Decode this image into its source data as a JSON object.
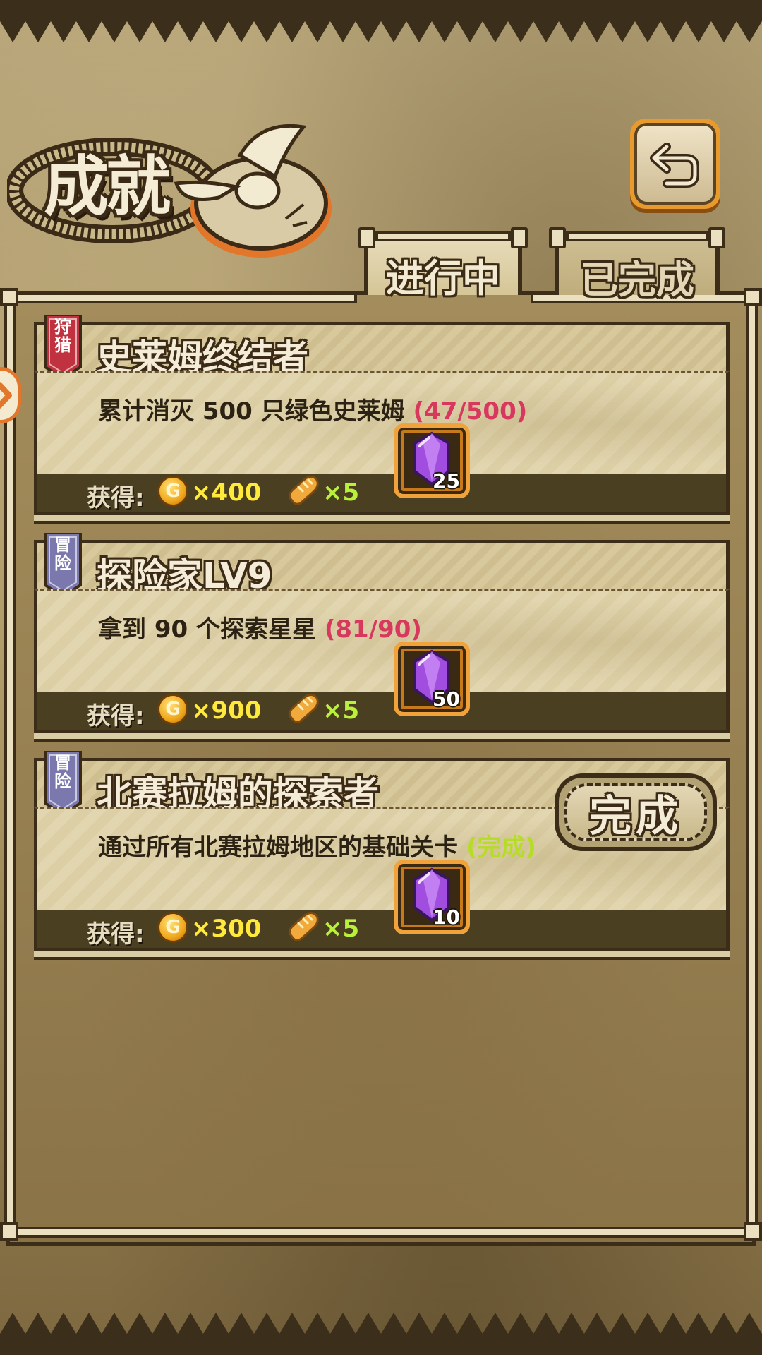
{
  "screen": {
    "title": "成就",
    "back_icon": "return-arrow-icon"
  },
  "tabs": [
    {
      "label": "进行中",
      "active": true
    },
    {
      "label": "已完成",
      "active": false
    }
  ],
  "achievements": [
    {
      "category": "狩猎",
      "category_color": "#c0323f",
      "title": "史莱姆终结者",
      "description": "累计消灭 500 只绿色史莱姆",
      "progress": "(47/500)",
      "reward_label": "获得:",
      "coin_symbol": "G",
      "coins": "×400",
      "bread": "×5",
      "gems": "25",
      "completed": false
    },
    {
      "category": "冒险",
      "category_color": "#7a78ad",
      "title": "探险家LV9",
      "description": "拿到 90 个探索星星",
      "progress": "(81/90)",
      "reward_label": "获得:",
      "coin_symbol": "G",
      "coins": "×900",
      "bread": "×5",
      "gems": "50",
      "completed": false
    },
    {
      "category": "冒险",
      "category_color": "#7a78ad",
      "title": "北赛拉姆的探索者",
      "description": "通过所有北赛拉姆地区的基础关卡",
      "progress": "(完成)",
      "reward_label": "获得:",
      "coin_symbol": "G",
      "coins": "×300",
      "bread": "×5",
      "gems": "10",
      "completed": true,
      "button_label": "完成"
    }
  ],
  "colors": {
    "progress_pending": "#d8385e",
    "progress_done": "#b6dc25",
    "coin_amount": "#ffe93a",
    "bread_amount": "#b8f03a",
    "frame_dark": "#3c2d18",
    "accent_orange": "#f2a23a"
  }
}
